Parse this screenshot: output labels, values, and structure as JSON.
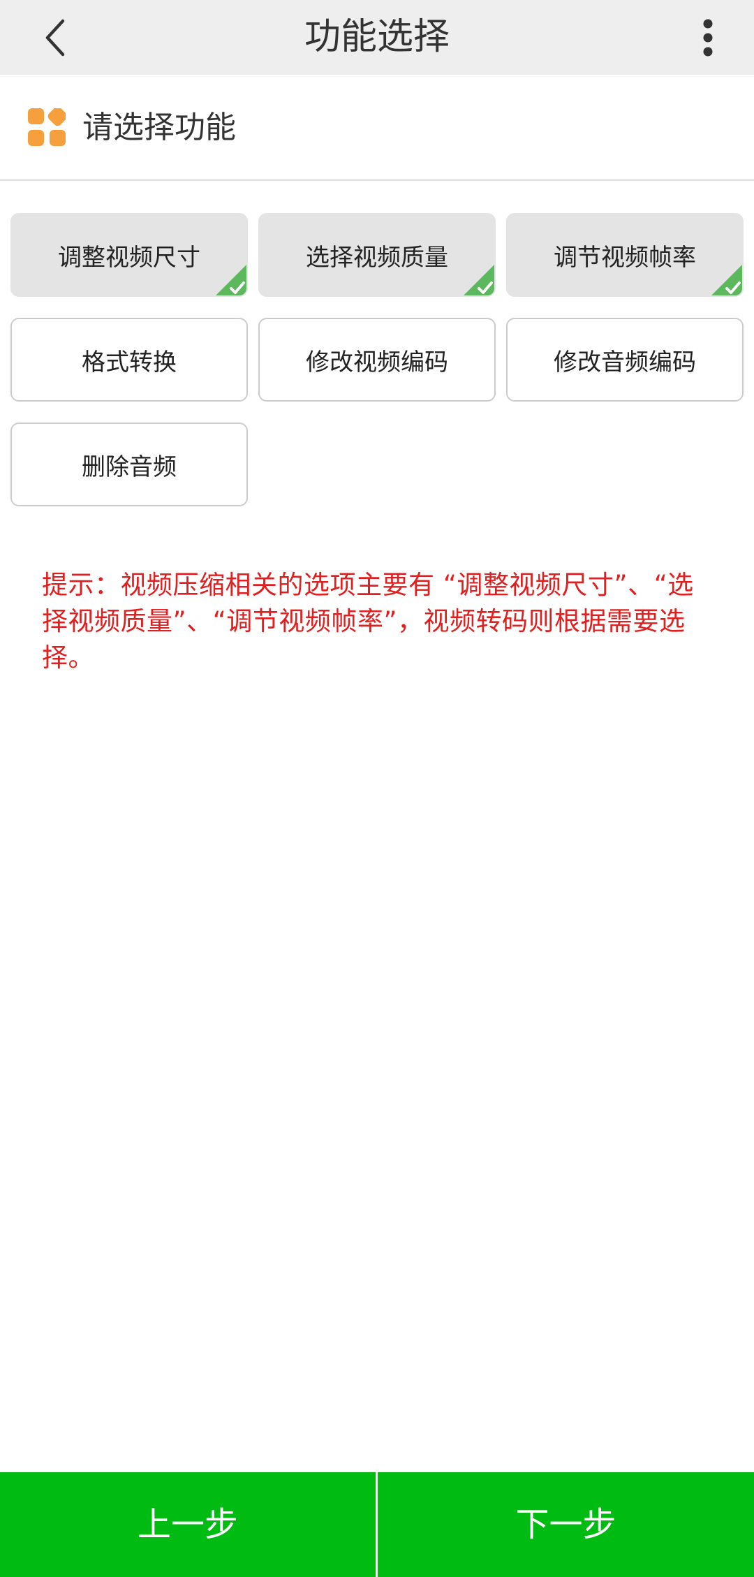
{
  "header": {
    "title": "功能选择",
    "back_icon": "chevron-left-icon",
    "more_icon": "more-vertical-icon"
  },
  "section": {
    "title": "请选择功能",
    "icon": "grid-apps-icon",
    "icon_color": "#f5a03c"
  },
  "options": [
    {
      "label": "调整视频尺寸",
      "selected": true
    },
    {
      "label": "选择视频质量",
      "selected": true
    },
    {
      "label": "调节视频帧率",
      "selected": true
    },
    {
      "label": "格式转换",
      "selected": false
    },
    {
      "label": "修改视频编码",
      "selected": false
    },
    {
      "label": "修改音频编码",
      "selected": false
    },
    {
      "label": "删除音频",
      "selected": false
    }
  ],
  "hint": "提示：视频压缩相关的选项主要有 “调整视频尺寸”、“选择视频质量”、“调节视频帧率”，视频转码则根据需要选择。",
  "footer": {
    "prev_label": "上一步",
    "next_label": "下一步"
  },
  "colors": {
    "accent_green": "#00bb12",
    "check_green": "#5cb85c",
    "hint_red": "#e02020",
    "header_bg": "#eeeeee"
  }
}
